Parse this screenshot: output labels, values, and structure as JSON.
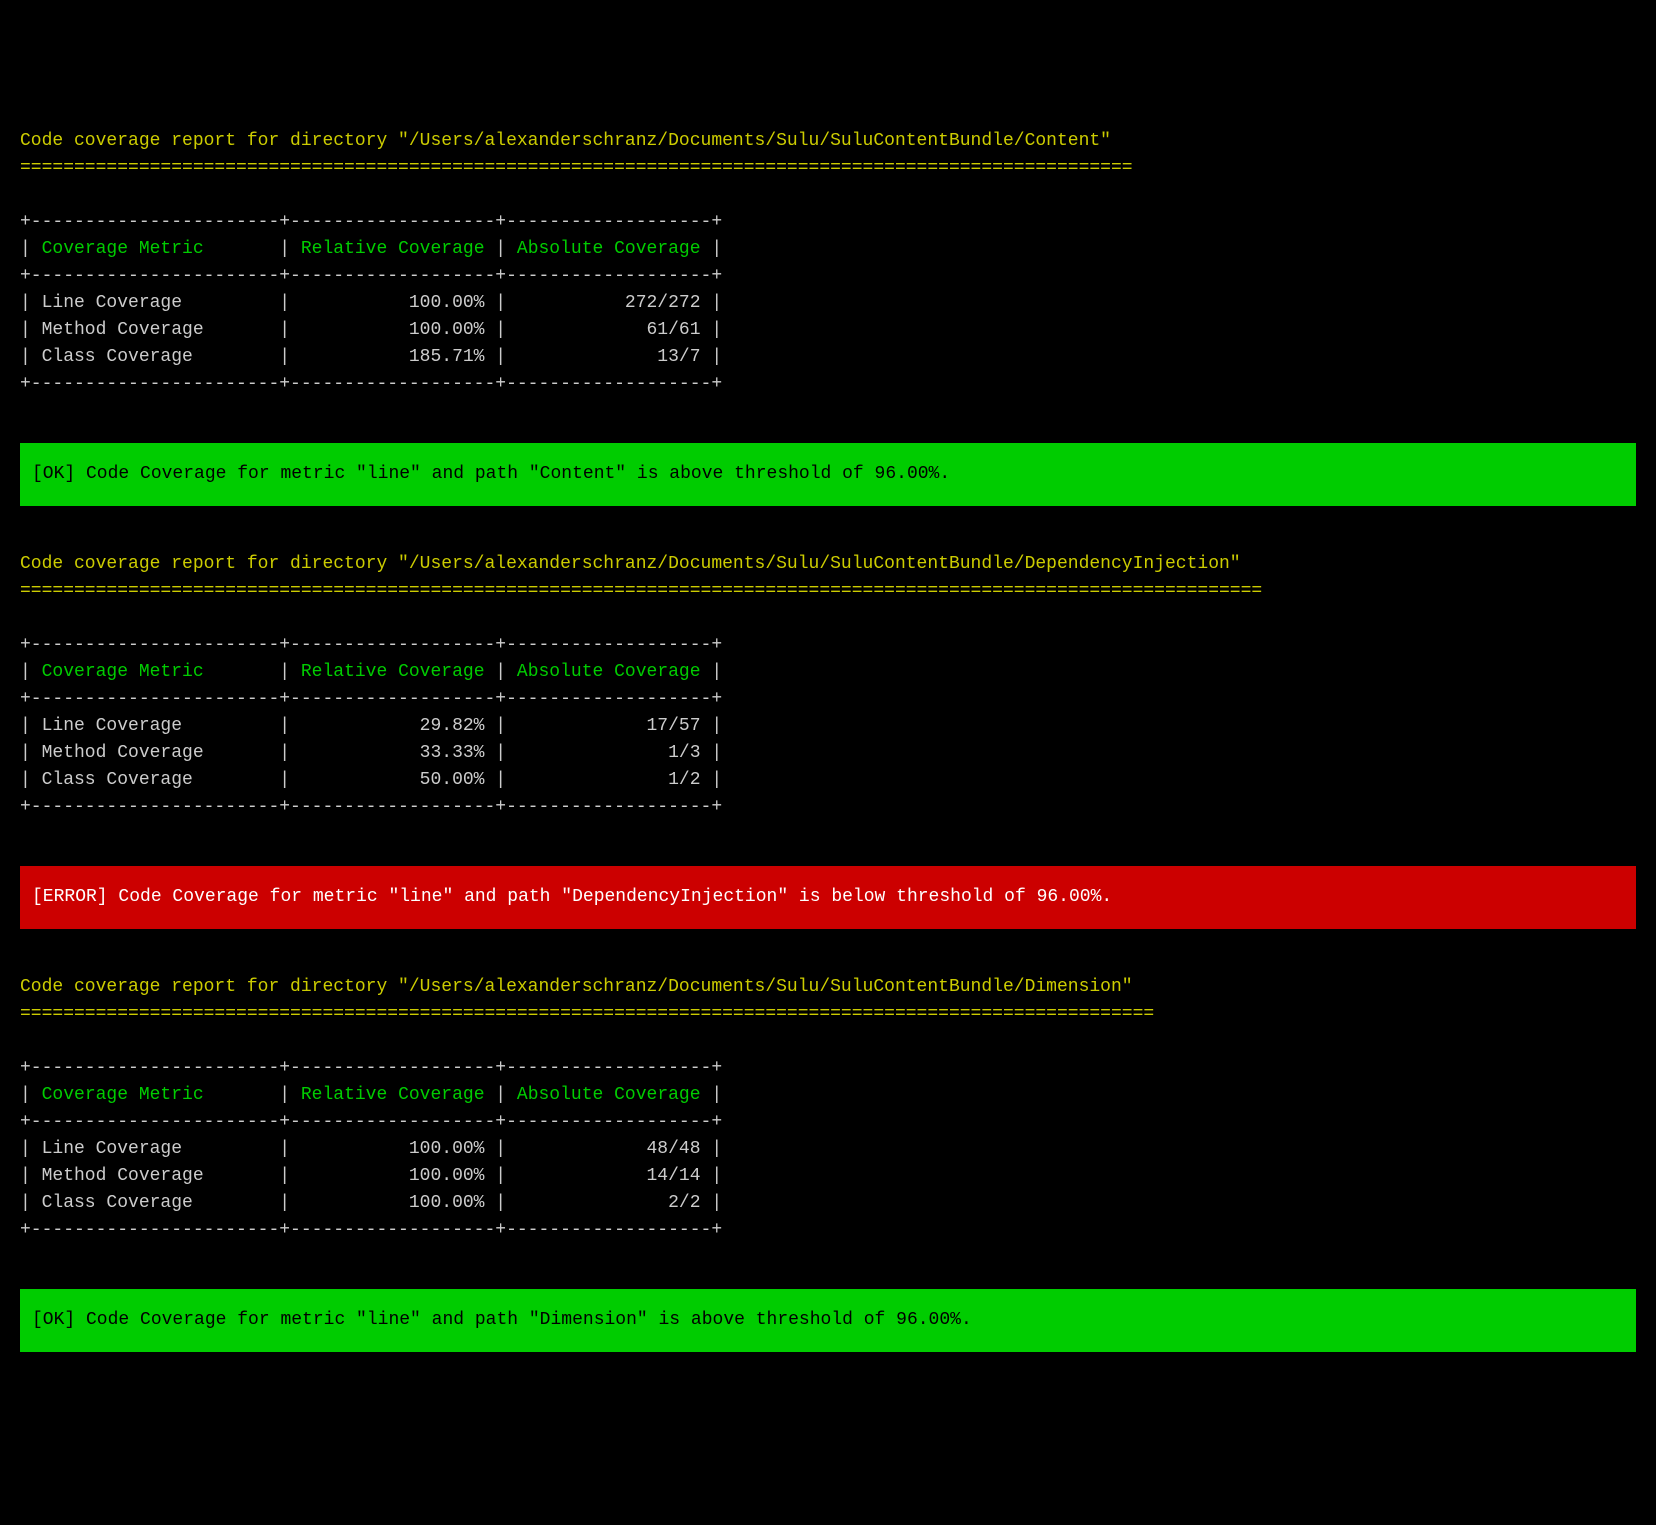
{
  "reports": [
    {
      "title": "Code coverage report for directory \"/Users/alexanderschranz/Documents/Sulu/SuluContentBundle/Content\"",
      "underline": "=======================================================================================================",
      "headers": {
        "col1": "Coverage Metric",
        "col2": "Relative Coverage",
        "col3": "Absolute Coverage"
      },
      "rows": [
        {
          "metric": "Line Coverage",
          "relative": "100.00%",
          "absolute": "272/272"
        },
        {
          "metric": "Method Coverage",
          "relative": "100.00%",
          "absolute": "61/61"
        },
        {
          "metric": "Class Coverage",
          "relative": "185.71%",
          "absolute": "13/7"
        }
      ],
      "status": {
        "type": "ok",
        "text": "[OK] Code Coverage for metric \"line\" and path \"Content\" is above threshold of 96.00%."
      }
    },
    {
      "title": "Code coverage report for directory \"/Users/alexanderschranz/Documents/Sulu/SuluContentBundle/DependencyInjection\"",
      "underline": "===================================================================================================================",
      "headers": {
        "col1": "Coverage Metric",
        "col2": "Relative Coverage",
        "col3": "Absolute Coverage"
      },
      "rows": [
        {
          "metric": "Line Coverage",
          "relative": "29.82%",
          "absolute": "17/57"
        },
        {
          "metric": "Method Coverage",
          "relative": "33.33%",
          "absolute": "1/3"
        },
        {
          "metric": "Class Coverage",
          "relative": "50.00%",
          "absolute": "1/2"
        }
      ],
      "status": {
        "type": "error",
        "text": "[ERROR] Code Coverage for metric \"line\" and path \"DependencyInjection\" is below threshold of 96.00%."
      }
    },
    {
      "title": "Code coverage report for directory \"/Users/alexanderschranz/Documents/Sulu/SuluContentBundle/Dimension\"",
      "underline": "=========================================================================================================",
      "headers": {
        "col1": "Coverage Metric",
        "col2": "Relative Coverage",
        "col3": "Absolute Coverage"
      },
      "rows": [
        {
          "metric": "Line Coverage",
          "relative": "100.00%",
          "absolute": "48/48"
        },
        {
          "metric": "Method Coverage",
          "relative": "100.00%",
          "absolute": "14/14"
        },
        {
          "metric": "Class Coverage",
          "relative": "100.00%",
          "absolute": "2/2"
        }
      ],
      "status": {
        "type": "ok",
        "text": "[OK] Code Coverage for metric \"line\" and path \"Dimension\" is above threshold of 96.00%."
      }
    }
  ],
  "tableBorder": {
    "divider": "+-----------------------+-------------------+-------------------+"
  }
}
